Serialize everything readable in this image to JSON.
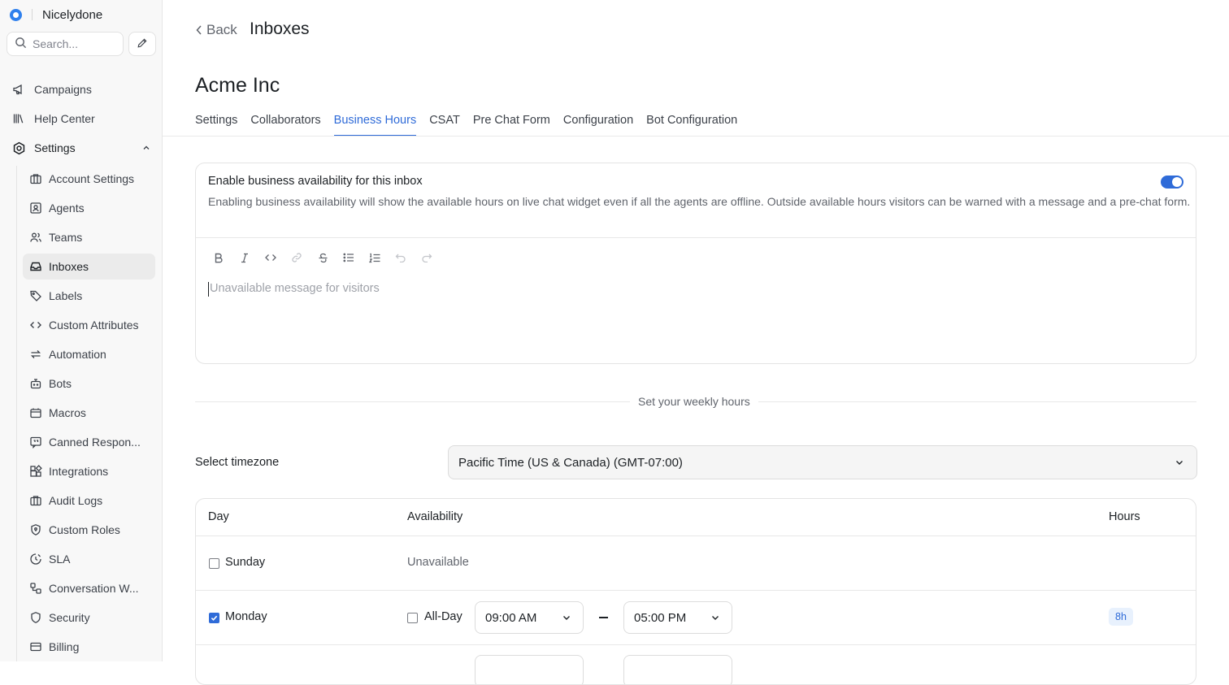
{
  "brand": {
    "name": "Nicelydone"
  },
  "search": {
    "placeholder": "Search..."
  },
  "nav": [
    {
      "label": "Campaigns",
      "icon": "megaphone-icon"
    },
    {
      "label": "Help Center",
      "icon": "library-icon"
    },
    {
      "label": "Settings",
      "icon": "settings-icon"
    }
  ],
  "settings_items": [
    {
      "label": "Account Settings",
      "icon": "briefcase-icon"
    },
    {
      "label": "Agents",
      "icon": "agent-icon"
    },
    {
      "label": "Teams",
      "icon": "teams-icon"
    },
    {
      "label": "Inboxes",
      "icon": "inbox-icon",
      "active": true
    },
    {
      "label": "Labels",
      "icon": "tag-icon"
    },
    {
      "label": "Custom Attributes",
      "icon": "code-icon"
    },
    {
      "label": "Automation",
      "icon": "automation-icon"
    },
    {
      "label": "Bots",
      "icon": "bot-icon"
    },
    {
      "label": "Macros",
      "icon": "macro-icon"
    },
    {
      "label": "Canned Respon...",
      "icon": "canned-response-icon"
    },
    {
      "label": "Integrations",
      "icon": "integrations-icon"
    },
    {
      "label": "Audit Logs",
      "icon": "audit-log-icon"
    },
    {
      "label": "Custom Roles",
      "icon": "shield-icon"
    },
    {
      "label": "SLA",
      "icon": "sla-icon"
    },
    {
      "label": "Conversation W...",
      "icon": "workflow-icon"
    },
    {
      "label": "Security",
      "icon": "security-icon"
    },
    {
      "label": "Billing",
      "icon": "billing-icon"
    }
  ],
  "header": {
    "back_label": "Back",
    "title": "Inboxes"
  },
  "inbox": {
    "name": "Acme Inc"
  },
  "tabs": [
    {
      "label": "Settings"
    },
    {
      "label": "Collaborators"
    },
    {
      "label": "Business Hours",
      "active": true
    },
    {
      "label": "CSAT"
    },
    {
      "label": "Pre Chat Form"
    },
    {
      "label": "Configuration"
    },
    {
      "label": "Bot Configuration"
    }
  ],
  "availability": {
    "title": "Enable business availability for this inbox",
    "description": "Enabling business availability will show the available hours on live chat widget even if all the agents are offline. Outside available hours visitors can be warned with a message and a pre-chat form.",
    "enabled": true,
    "editor_placeholder": "Unavailable message for visitors"
  },
  "weekly": {
    "section_label": "Set your weekly hours"
  },
  "timezone": {
    "label": "Select timezone",
    "value": "Pacific Time (US & Canada) (GMT-07:00)"
  },
  "hours_table": {
    "headers": {
      "day": "Day",
      "availability": "Availability",
      "hours": "Hours"
    },
    "rows": [
      {
        "day": "Sunday",
        "checked": false,
        "availability": "Unavailable"
      },
      {
        "day": "Monday",
        "checked": true,
        "all_day_label": "All-Day",
        "from": "09:00 AM",
        "to": "05:00 PM",
        "hours": "8h"
      }
    ]
  },
  "colors": {
    "accent": "#2f6bd8",
    "sidebar_bg": "#f8f8f8"
  }
}
